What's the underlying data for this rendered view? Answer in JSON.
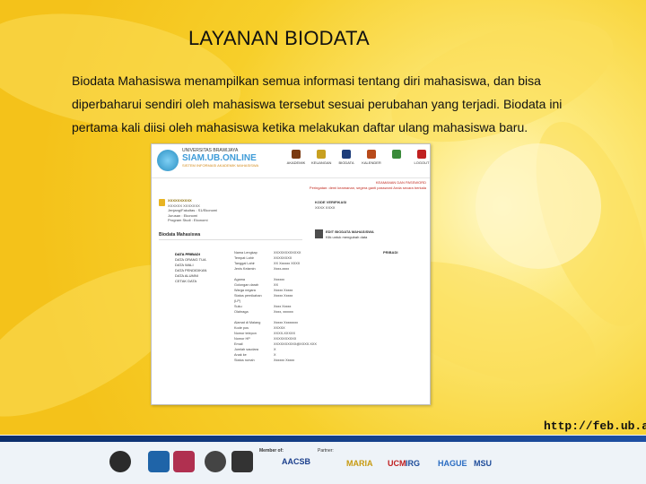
{
  "slide": {
    "title": "LAYANAN BIODATA",
    "paragraph_lines": [
      "Biodata Mahasiswa menampilkan semua informasi tentang diri mahasiswa, dan bisa",
      "diperbaharui sendiri oleh mahasiswa tersebut sesuai perubahan yang terjadi. Biodata ini",
      "pertama kali diisi oleh mahasiswa ketika melakukan daftar ulang mahasiswa baru."
    ],
    "url": "http://feb.ub.ac.id"
  },
  "screenshot": {
    "brand": {
      "university": "UNIVERSITAS BRAWIJAYA",
      "system": "SIAM.UB.ONLINE",
      "tagline": "SISTEM INFORMASI AKADEMIK MAHASISWA"
    },
    "nav": [
      {
        "label": "AKADEMIK",
        "color": "#7a3a12"
      },
      {
        "label": "KEUANGAN",
        "color": "#c8a020"
      },
      {
        "label": "BIODATA",
        "color": "#1d3d7a"
      },
      {
        "label": "KALENDER",
        "color": "#b84a1a"
      },
      {
        "label": "",
        "color": "#3a8a3a"
      },
      {
        "label": "LOGOUT",
        "color": "#c02020"
      }
    ],
    "notice_lines": [
      "KEAMANAN DAN PASSWORD",
      "Peringatan: demi keamanan, segera ganti password Anda secara berkala"
    ],
    "user_lines": [
      "XXXXXXXXXX",
      "XXXXXX XXXXXXX",
      "Jenjang/Fakultas : S1/Ekonomi",
      "Jurusan : Ekonomi",
      "Program Studi : Ekonomi"
    ],
    "right_box": {
      "heading": "KODE VERIFIKASI",
      "value": "XXXX XXXX"
    },
    "section_title": "Biodata Mahasiswa",
    "edit_box": {
      "heading": "EDIT BIODATA MAHASISWA",
      "text": "Klik untuk mengubah data"
    },
    "side_list": [
      "DATA PRIBADI",
      "DATA ORANG TUA",
      "DATA WALI",
      "DATA PENDIDIKAN",
      "DATA ALUMNI",
      "CETAK DATA"
    ],
    "badge": "PRIBADI",
    "fields": [
      {
        "k": "Nama Lengkap",
        "v": "XXXXXXXXXXXX"
      },
      {
        "k": "Tempat Lahir",
        "v": "XXXXXXXX"
      },
      {
        "k": "Tanggal Lahir",
        "v": "XX Xxxxxx XXXX"
      },
      {
        "k": "Jenis Kelamin",
        "v": "Xxxx-xxxx"
      },
      {
        "k": "",
        "v": ""
      },
      {
        "k": "Agama",
        "v": "Xxxxxx"
      },
      {
        "k": "Golongan darah",
        "v": "XX"
      },
      {
        "k": "Warga negara",
        "v": "Xxxxx Xxxxx"
      },
      {
        "k": "Status pernikahan",
        "v": "Xxxxx Xxxxx"
      },
      {
        "k": "(LP)",
        "v": ""
      },
      {
        "k": "Suku",
        "v": "Xxxx Xxxxx"
      },
      {
        "k": "Olahraga",
        "v": "Xxxx, xxxxxx"
      },
      {
        "k": "",
        "v": ""
      },
      {
        "k": "Alamat di Malang",
        "v": "Xxxxx Xxxxxxxx"
      },
      {
        "k": "Kode pos",
        "v": "XXXXX"
      },
      {
        "k": "Nomor telepon",
        "v": "XXXX-XXXXX"
      },
      {
        "k": "Nomor HP",
        "v": "XXXXXXXXXX"
      },
      {
        "k": "Email",
        "v": "XXXXXXXXXX@XXXX.XXX"
      },
      {
        "k": "Jumlah saudara",
        "v": "X"
      },
      {
        "k": "Anak ke",
        "v": "X"
      },
      {
        "k": "Status rumah",
        "v": "Xxxxxx Xxxxx"
      }
    ]
  },
  "footer": {
    "member_label": "Member of:",
    "partner_label": "Partner:",
    "logos": [
      {
        "name": "crest-icon",
        "color": "#2b2b2b"
      },
      {
        "name": "globe-icon",
        "color": "#1f64a8"
      },
      {
        "name": "badge-icon",
        "color": "#b03050"
      },
      {
        "name": "seal-icon",
        "color": "#444444"
      },
      {
        "name": "r-icon",
        "color": "#333333"
      }
    ],
    "texts": [
      {
        "text": "AACSB",
        "color": "#1b3f8c"
      },
      {
        "text": "MARIA",
        "color": "#c79a10"
      },
      {
        "text": "UCM",
        "color": "#c02020"
      },
      {
        "text": "IRG",
        "color": "#1e4c9a"
      },
      {
        "text": "HAGUE",
        "color": "#2a6cc2"
      },
      {
        "text": "MSU",
        "color": "#1e4c9a"
      }
    ]
  }
}
